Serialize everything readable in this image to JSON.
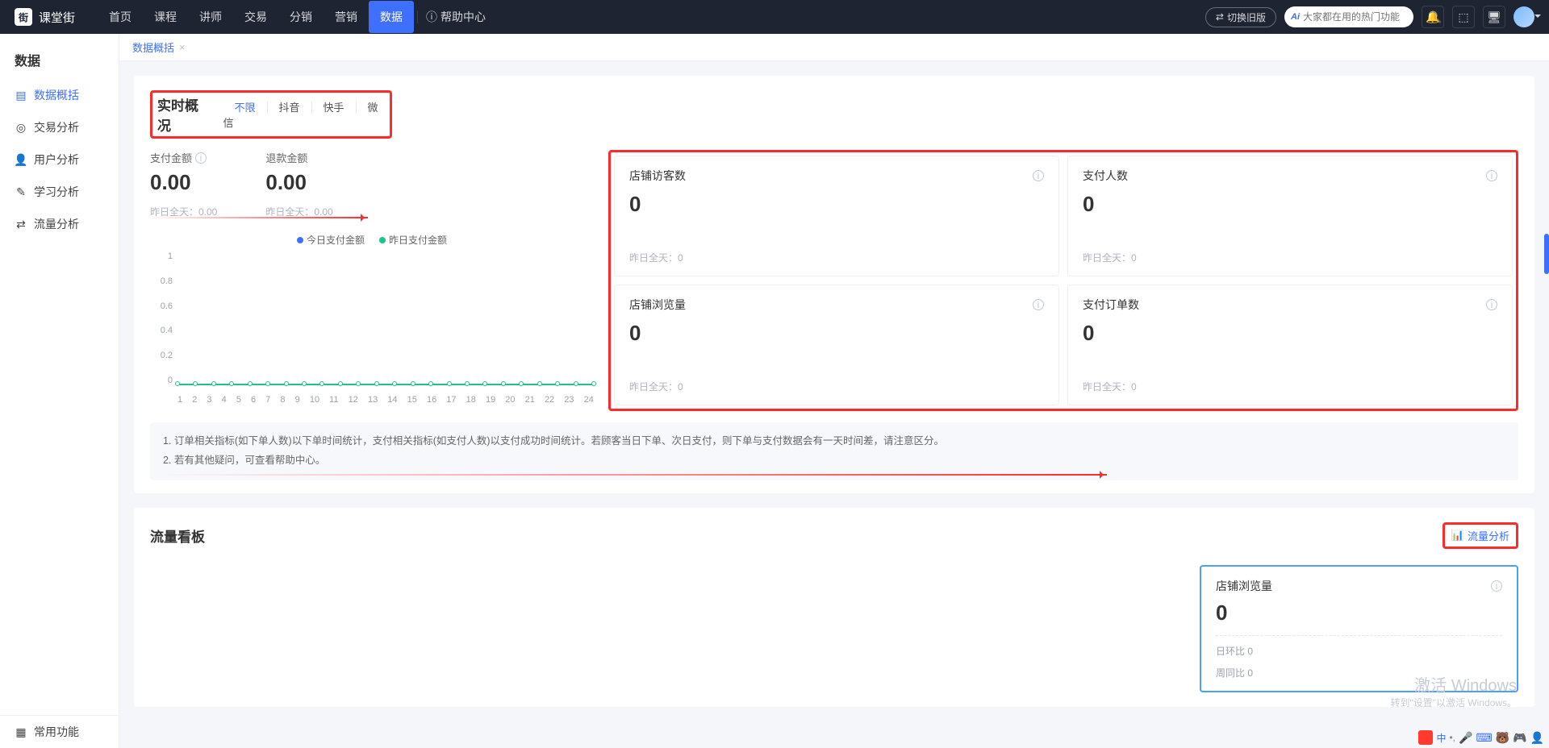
{
  "brand": "课堂街",
  "nav": {
    "items": [
      "首页",
      "课程",
      "讲师",
      "交易",
      "分销",
      "营销",
      "数据"
    ],
    "activeIndex": 6,
    "help": "帮助中心"
  },
  "topRight": {
    "switch": "切换旧版",
    "searchPlaceholder": "大家都在用的热门功能"
  },
  "sidebar": {
    "title": "数据",
    "items": [
      {
        "label": "数据概括",
        "icon": "doc"
      },
      {
        "label": "交易分析",
        "icon": "target"
      },
      {
        "label": "用户分析",
        "icon": "user"
      },
      {
        "label": "学习分析",
        "icon": "book"
      },
      {
        "label": "流量分析",
        "icon": "flow"
      }
    ],
    "activeIndex": 0,
    "footer": "常用功能"
  },
  "tabs": [
    {
      "label": "数据概括"
    }
  ],
  "realtime": {
    "title": "实时概况",
    "filters": [
      "不限",
      "抖音",
      "快手",
      "微信"
    ],
    "activeFilter": 0,
    "pay": {
      "label": "支付金额",
      "value": "0.00",
      "sub": "昨日全天：0.00"
    },
    "refund": {
      "label": "退款金额",
      "value": "0.00",
      "sub": "昨日全天：0.00"
    },
    "legend": {
      "today": "今日支付金额",
      "yesterday": "昨日支付金额"
    },
    "cards": [
      {
        "title": "店铺访客数",
        "value": "0",
        "sub": "昨日全天：0"
      },
      {
        "title": "支付人数",
        "value": "0",
        "sub": "昨日全天：0"
      },
      {
        "title": "店铺浏览量",
        "value": "0",
        "sub": "昨日全天：0"
      },
      {
        "title": "支付订单数",
        "value": "0",
        "sub": "昨日全天：0"
      }
    ],
    "notes": [
      "1. 订单相关指标(如下单人数)以下单时间统计，支付相关指标(如支付人数)以支付成功时间统计。若顾客当日下单、次日支付，则下单与支付数据会有一天时间差，请注意区分。",
      "2. 若有其他疑问，可查看帮助中心。"
    ]
  },
  "chart_data": {
    "type": "line",
    "x": [
      1,
      2,
      3,
      4,
      5,
      6,
      7,
      8,
      9,
      10,
      11,
      12,
      13,
      14,
      15,
      16,
      17,
      18,
      19,
      20,
      21,
      22,
      23,
      24
    ],
    "series": [
      {
        "name": "今日支付金额",
        "values": [
          0,
          0,
          0,
          0,
          0,
          0,
          0,
          0,
          0,
          0,
          0,
          0,
          0,
          0,
          0,
          0,
          0,
          0,
          0,
          0,
          0,
          0,
          0,
          0
        ]
      },
      {
        "name": "昨日支付金额",
        "values": [
          0,
          0,
          0,
          0,
          0,
          0,
          0,
          0,
          0,
          0,
          0,
          0,
          0,
          0,
          0,
          0,
          0,
          0,
          0,
          0,
          0,
          0,
          0,
          0
        ]
      }
    ],
    "ylim": [
      0,
      1
    ],
    "yticks": [
      0,
      0.2,
      0.4,
      0.6,
      0.8,
      1
    ],
    "xlabel": "",
    "ylabel": ""
  },
  "trafficBoard": {
    "title": "流量看板",
    "link": "流量分析",
    "tile": {
      "title": "店铺浏览量",
      "value": "0",
      "daily": "日环比 0",
      "weekly": "周同比 0"
    }
  },
  "watermark": {
    "l1": "激活 Windows",
    "l2": "转到\"设置\"以激活 Windows。"
  }
}
